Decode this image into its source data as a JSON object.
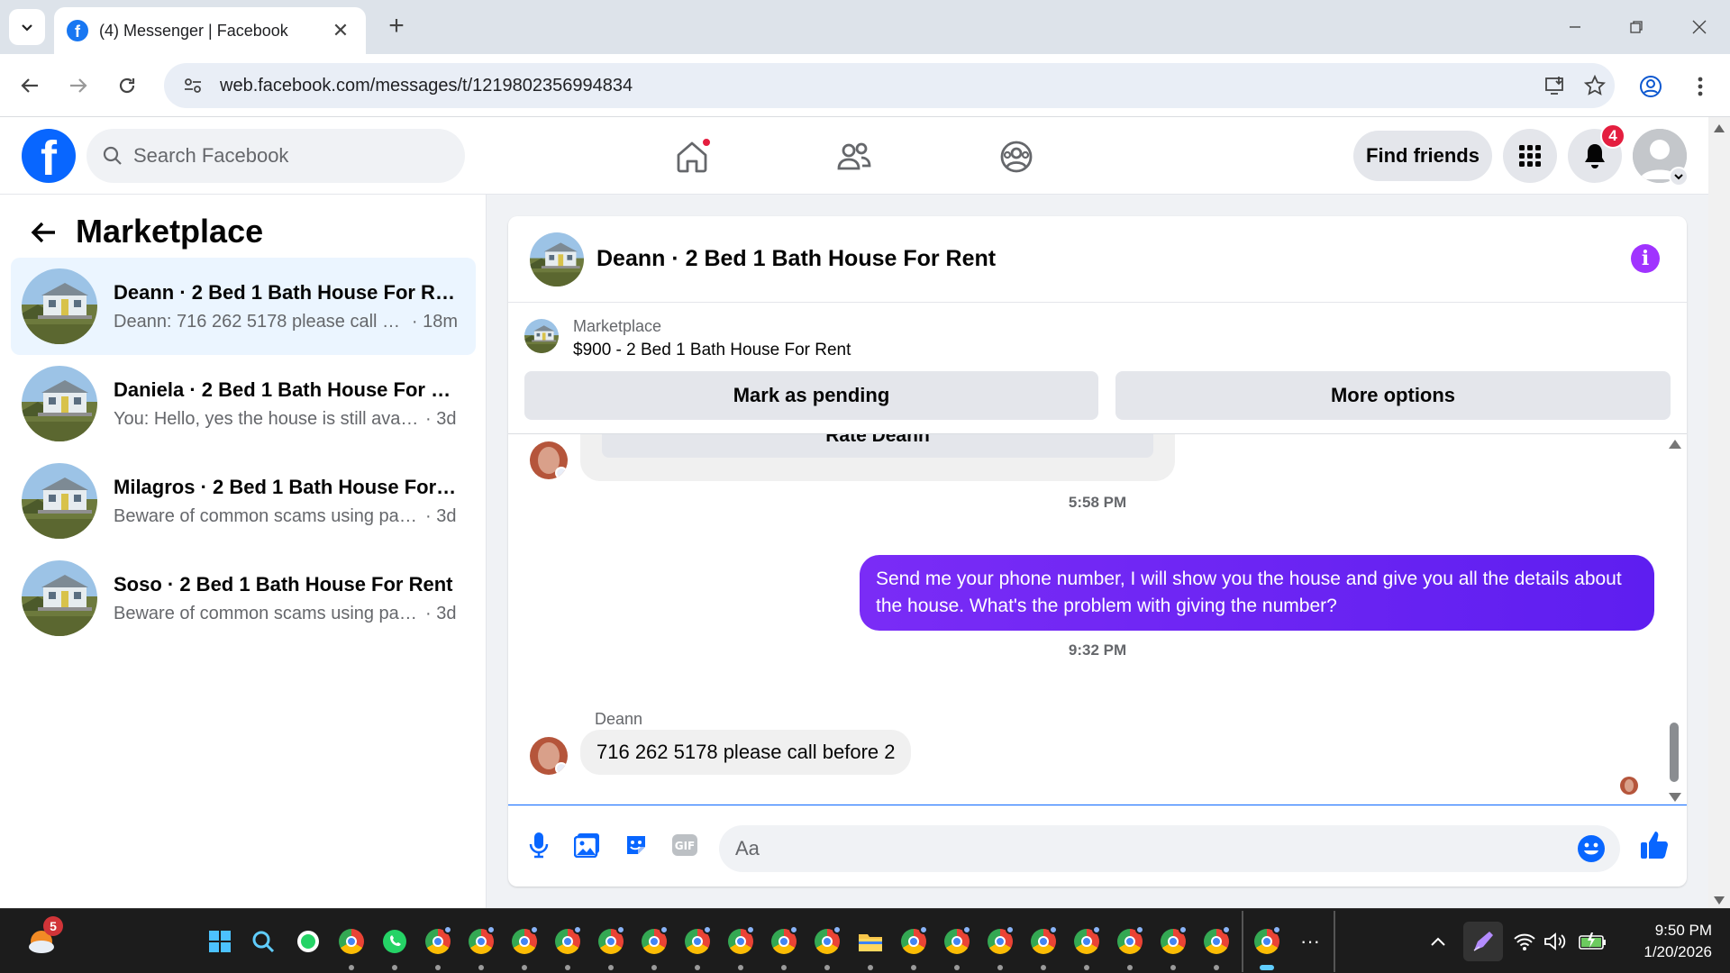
{
  "browser": {
    "tab_title": "(4) Messenger | Facebook",
    "url": "web.facebook.com/messages/t/1219802356994834"
  },
  "fb": {
    "search_placeholder": "Search Facebook",
    "find_friends_label": "Find friends",
    "notification_count": "4"
  },
  "sidebar": {
    "title": "Marketplace",
    "conversations": [
      {
        "name": "Deann · 2 Bed 1 Bath House For Re...",
        "snippet": "Deann: 716 262 5178 please call bef...",
        "time": "· 18m",
        "active": true
      },
      {
        "name": "Daniela · 2 Bed 1 Bath House For R...",
        "snippet": "You: Hello, yes the house is still availa...",
        "time": "· 3d",
        "active": false
      },
      {
        "name": "Milagros · 2 Bed 1 Bath House For ...",
        "snippet": "Beware of common scams using pay...",
        "time": "· 3d",
        "active": false
      },
      {
        "name": "Soso · 2 Bed 1 Bath House For Rent",
        "snippet": "Beware of common scams using pay...",
        "time": "· 3d",
        "active": false
      }
    ]
  },
  "chat": {
    "title": "Deann · 2 Bed 1 Bath House For Rent",
    "listing_label": "Marketplace",
    "listing_price_title": "$900 - 2 Bed 1 Bath House For Rent",
    "mark_pending_label": "Mark as pending",
    "more_options_label": "More options",
    "rate_label": "Rate Deann",
    "time1": "5:58 PM",
    "outgoing_message": "Send me your phone number, I will show you the house and give you all the details about the house. What's the problem with giving the number?",
    "time2": "9:32 PM",
    "sender_name": "Deann",
    "incoming_message": "716 262 5178 please call before 2",
    "composer_placeholder": "Aa"
  },
  "taskbar": {
    "weather_badge": "5",
    "time": "9:50 PM",
    "date": "1/20/2026",
    "overflow": "···"
  },
  "colors": {
    "fb_blue": "#0866ff",
    "messenger_purple": "#6418f2",
    "notification_red": "#e41e3f"
  }
}
